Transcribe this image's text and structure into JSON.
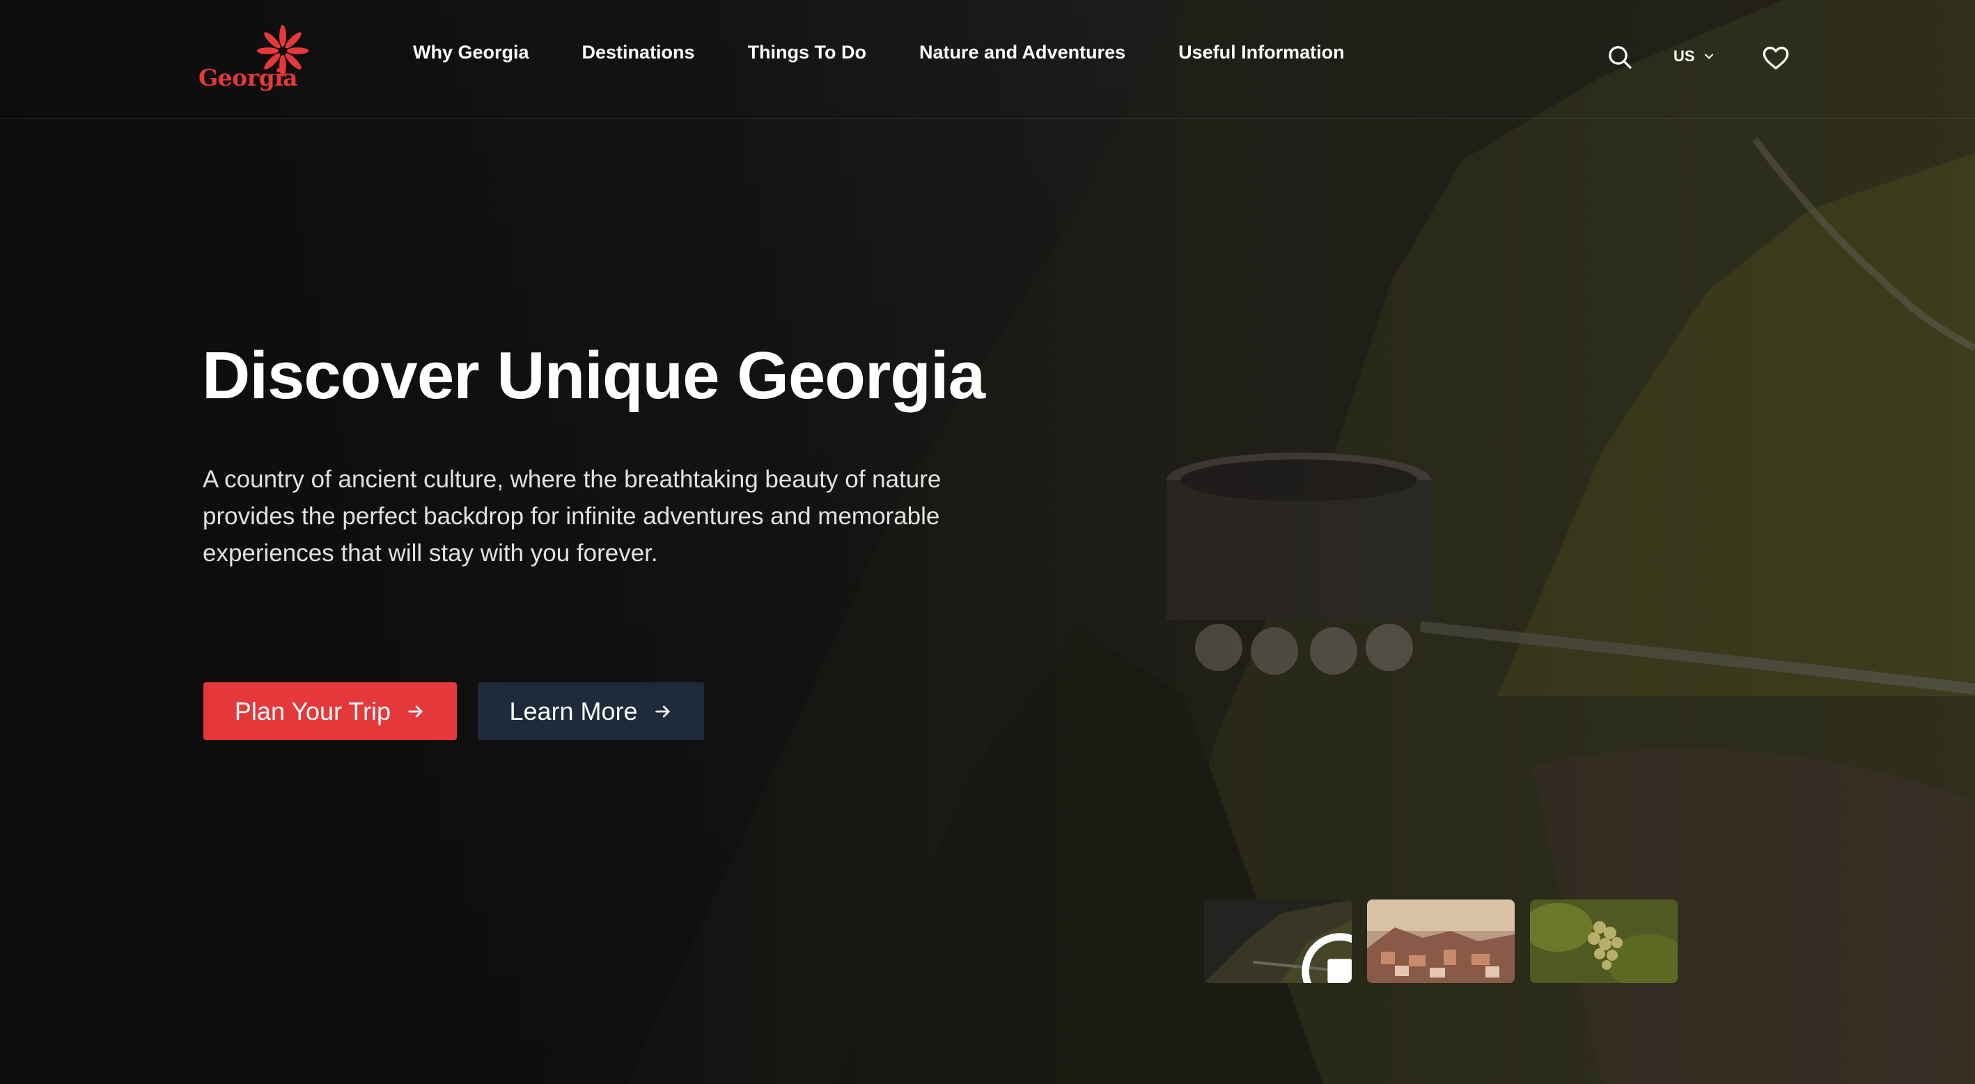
{
  "header": {
    "logo_text": "Georgia",
    "nav": [
      "Why Georgia",
      "Destinations",
      "Things To Do",
      "Nature and Adventures",
      "Useful Information"
    ],
    "search_icon": "search-icon",
    "language": "US",
    "language_icon": "chevron-down-icon",
    "favorites_icon": "heart-icon"
  },
  "hero": {
    "title": "Discover Unique Georgia",
    "description": "A country of ancient culture, where the breathtaking beauty of nature provides the perfect backdrop for infinite adventures and memorable experiences that will stay with you forever.",
    "primary_cta": "Plan Your Trip",
    "secondary_cta": "Learn More",
    "cta_icon": "arrow-right-icon"
  },
  "slider": {
    "thumbnails": [
      "mountain-monument-thumbnail",
      "old-town-city-thumbnail",
      "vineyard-grapes-thumbnail"
    ],
    "active_thumbnail": 1,
    "control_icon": "stop-icon"
  },
  "colors": {
    "brand": "#e5383b",
    "secondary_button": "#1f2a3a",
    "text": "#ffffff"
  }
}
